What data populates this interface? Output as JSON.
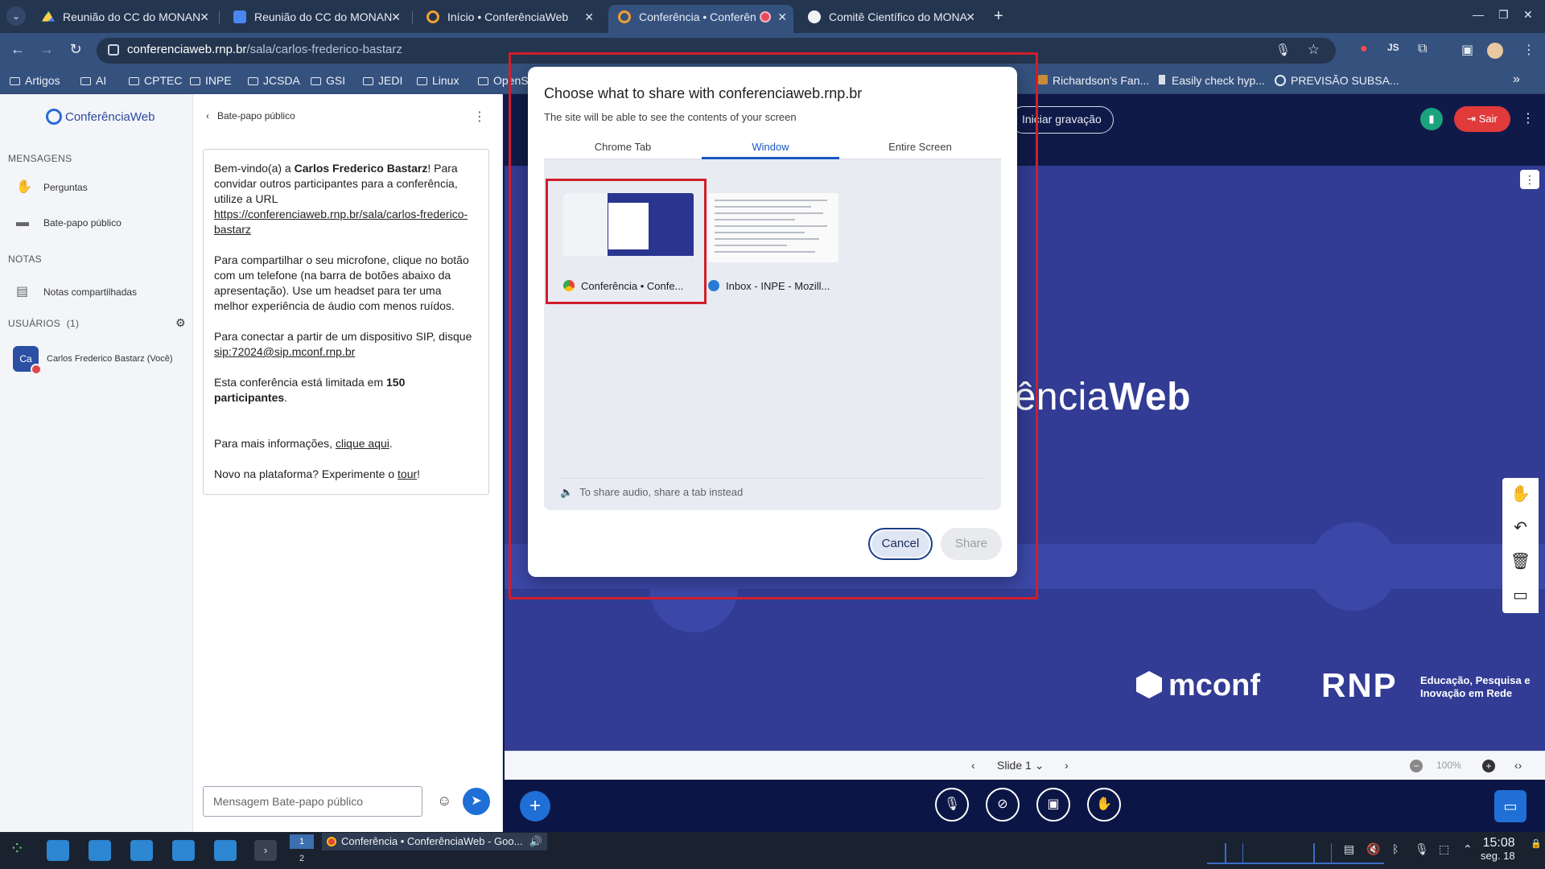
{
  "browser": {
    "tabs": [
      {
        "title": "Reunião do CC do MONAN",
        "icon": "google-drive-icon"
      },
      {
        "title": "Reunião do CC do MONAN",
        "icon": "google-docs-icon"
      },
      {
        "title": "Início • ConferênciaWeb",
        "icon": "conferenciaweb-icon"
      },
      {
        "title": "Conferência • Conferên",
        "icon": "conferenciaweb-icon",
        "active": true,
        "recording": true
      },
      {
        "title": "Comitê Científico do MONA",
        "icon": "github-icon"
      }
    ],
    "url_host": "conferenciaweb.rnp.br",
    "url_path": "/sala/carlos-frederico-bastarz",
    "bookmarks": [
      "Artigos",
      "AI",
      "CPTEC",
      "INPE",
      "JCSDA",
      "GSI",
      "JEDI",
      "Linux",
      "OpenS",
      "Richardson's Fan...",
      "Easily check hyp...",
      "PREVISÃO SUBSA..."
    ]
  },
  "sidebar": {
    "logo": "ConferênciaWeb",
    "messages_heading": "MENSAGENS",
    "questions": "Perguntas",
    "public_chat": "Bate-papo público",
    "notes_heading": "NOTAS",
    "shared_notes": "Notas compartilhadas",
    "users_heading": "USUÁRIOS",
    "users_count": "(1)",
    "user_initials": "Ca",
    "user_name": "Carlos Frederico Bastarz (Você)"
  },
  "chat": {
    "title": "Bate-papo público",
    "welcome": {
      "p1_a": "Bem-vindo(a) a ",
      "p1_name": "Carlos Frederico Bastarz",
      "p1_b": "! Para convidar outros participantes para a conferência, utilize a URL ",
      "p1_url": "https://conferenciaweb.rnp.br/sala/carlos-frederico-bastarz",
      "p2": "Para compartilhar o seu microfone, clique no botão com um telefone (na barra de botões abaixo da apresentação). Use um headset para ter uma melhor experiência de áudio com menos ruídos.",
      "p3_a": "Para conectar a partir de um dispositivo SIP, disque ",
      "p3_sip": "sip:72024@sip.mconf.rnp.br",
      "p4_a": "Esta conferência está limitada em ",
      "p4_num": "150 participantes",
      "p4_b": ".",
      "p5_a": "Para mais informações, ",
      "p5_link": "clique aqui",
      "p5_b": ".",
      "p6_a": "Novo na plataforma? Experimente o ",
      "p6_link": "tour",
      "p6_b": "!"
    },
    "input_placeholder": "Mensagem Bate-papo público"
  },
  "conference": {
    "record_label": "Iniciar gravação",
    "leave_label": "Sair",
    "slide_brand_a": "erência",
    "slide_brand_b": "Web",
    "mconf_logo": "mconf",
    "rnp_logo": "RNP",
    "rnp_tagline": "Educação, Pesquisa e Inovação em Rede",
    "slide_selector": "Slide 1",
    "zoom": "100%"
  },
  "share_dialog": {
    "title": "Choose what to share with conferenciaweb.rnp.br",
    "subtitle": "The site will be able to see the contents of your screen",
    "tabs": [
      "Chrome Tab",
      "Window",
      "Entire Screen"
    ],
    "active_tab": "Window",
    "windows": [
      {
        "label": "Conferência • Confe...",
        "icon": "chrome-icon",
        "selected": true
      },
      {
        "label": "Inbox - INPE - Mozill...",
        "icon": "thunderbird-icon",
        "selected": false
      }
    ],
    "audio_note": "To share audio, share a tab instead",
    "cancel_label": "Cancel",
    "share_label": "Share"
  },
  "taskbar": {
    "workspace_1": "1",
    "workspace_2": "2",
    "app_title": "Conferência • ConferênciaWeb - Goo...",
    "time": "15:08",
    "date": "seg. 18"
  },
  "colors": {
    "chrome_frame": "#35517e",
    "conference_bg": "#323c94",
    "accent_blue": "#1f6fd6",
    "leave_red": "#e03a3a",
    "highlight_red": "#d11e2a"
  }
}
